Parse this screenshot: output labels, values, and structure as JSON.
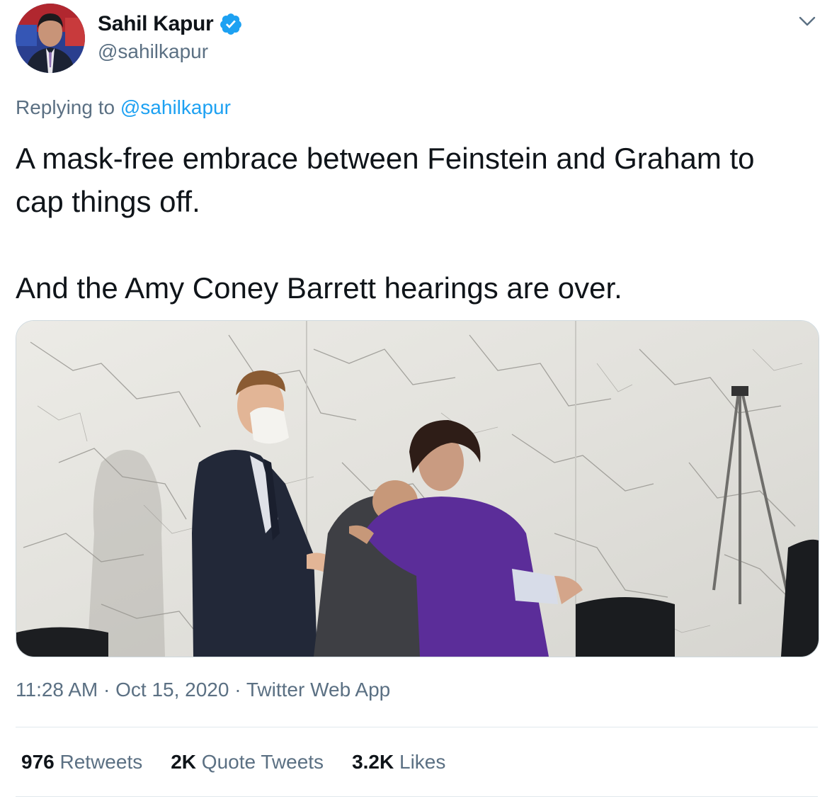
{
  "author": {
    "display_name": "Sahil Kapur",
    "handle": "@sahilkapur",
    "verified_icon": "verified-badge-icon"
  },
  "reply": {
    "prefix": "Replying to",
    "to": "@sahilkapur"
  },
  "tweet": {
    "paragraph_1": "A mask-free embrace between Feinstein and Graham to cap things off.",
    "paragraph_2": "And the Amy Coney Barrett hearings are over."
  },
  "meta": {
    "time": "11:28 AM",
    "sep1": "·",
    "date": "Oct 15, 2020",
    "sep2": "·",
    "source": "Twitter Web App"
  },
  "stats": {
    "retweets_count": "976",
    "retweets_label": "Retweets",
    "quotes_count": "2K",
    "quotes_label": "Quote Tweets",
    "likes_count": "3.2K",
    "likes_label": "Likes"
  },
  "colors": {
    "accent": "#1da1f2",
    "secondary_text": "#5b7083",
    "primary_text": "#0f1419",
    "divider": "#e1e8ed"
  }
}
